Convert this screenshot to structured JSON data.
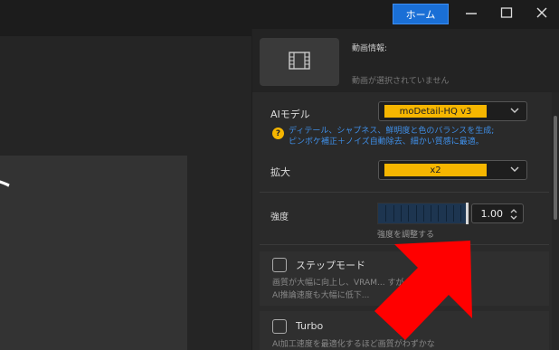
{
  "titlebar": {
    "home_label": "ホーム"
  },
  "left": {
    "card_text": "ト"
  },
  "video_info": {
    "label": "動画情報:",
    "empty_text": "動画が選択されていません"
  },
  "ai_model": {
    "label": "AIモデル",
    "value": "moDetail-HQ  v3",
    "hint_line1": "ディテール、シャプネス、鮮明度と色のバランスを生成;",
    "hint_line2": "ピンボケ補正＋ノイズ自動除去、細かい質感に最適。"
  },
  "upscale": {
    "label": "拡大",
    "value": "x2"
  },
  "strength": {
    "label": "強度",
    "value": "1.00",
    "hint": "強度を調整する",
    "level": 1.0
  },
  "step_mode": {
    "label": "ステップモード",
    "desc_line1": "画質が大幅に向上し、VRAM...                           すが、",
    "desc_line2": "AI推論速度も大幅に低下..."
  },
  "turbo": {
    "label": "Turbo",
    "desc_line1": "AI加工速度を最適化するほど画質がわずかな"
  },
  "colors": {
    "accent_blue": "#1a6fd6",
    "highlight_yellow": "#f6b600",
    "hint_blue": "#3f8fe8",
    "arrow_red": "#ff0000"
  }
}
